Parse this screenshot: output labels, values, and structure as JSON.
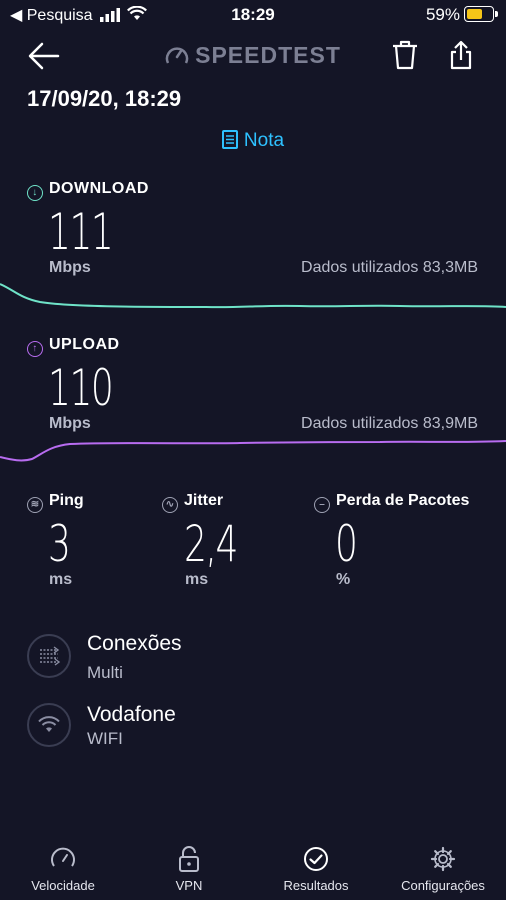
{
  "status_bar": {
    "back_app": "◀ Pesquisa",
    "time": "18:29",
    "battery_percent": "59%"
  },
  "header": {
    "brand": "SPEEDTEST",
    "date": "17/09/20, 18:29",
    "note_label": "Nota"
  },
  "download": {
    "label": "DOWNLOAD",
    "value": "111",
    "unit": "Mbps",
    "data_used": "Dados utilizados 83,3MB",
    "color": "#6fe3c8"
  },
  "upload": {
    "label": "UPLOAD",
    "value": "110",
    "unit": "Mbps",
    "data_used": "Dados utilizados 83,9MB",
    "color": "#b86cf0"
  },
  "metrics": [
    {
      "label": "Ping",
      "value": "3",
      "unit": "ms",
      "icon": "ping-icon"
    },
    {
      "label": "Jitter",
      "value": "2,4",
      "unit": "ms",
      "icon": "jitter-icon"
    },
    {
      "label": "Perda de Pacotes",
      "value": "0",
      "unit": "%",
      "icon": "packet-loss-icon"
    }
  ],
  "connections": {
    "title": "Conexões",
    "value": "Multi"
  },
  "network": {
    "provider": "Vodafone",
    "type": "WIFI"
  },
  "tabs": [
    {
      "label": "Velocidade"
    },
    {
      "label": "VPN"
    },
    {
      "label": "Resultados"
    },
    {
      "label": "Configurações"
    }
  ]
}
